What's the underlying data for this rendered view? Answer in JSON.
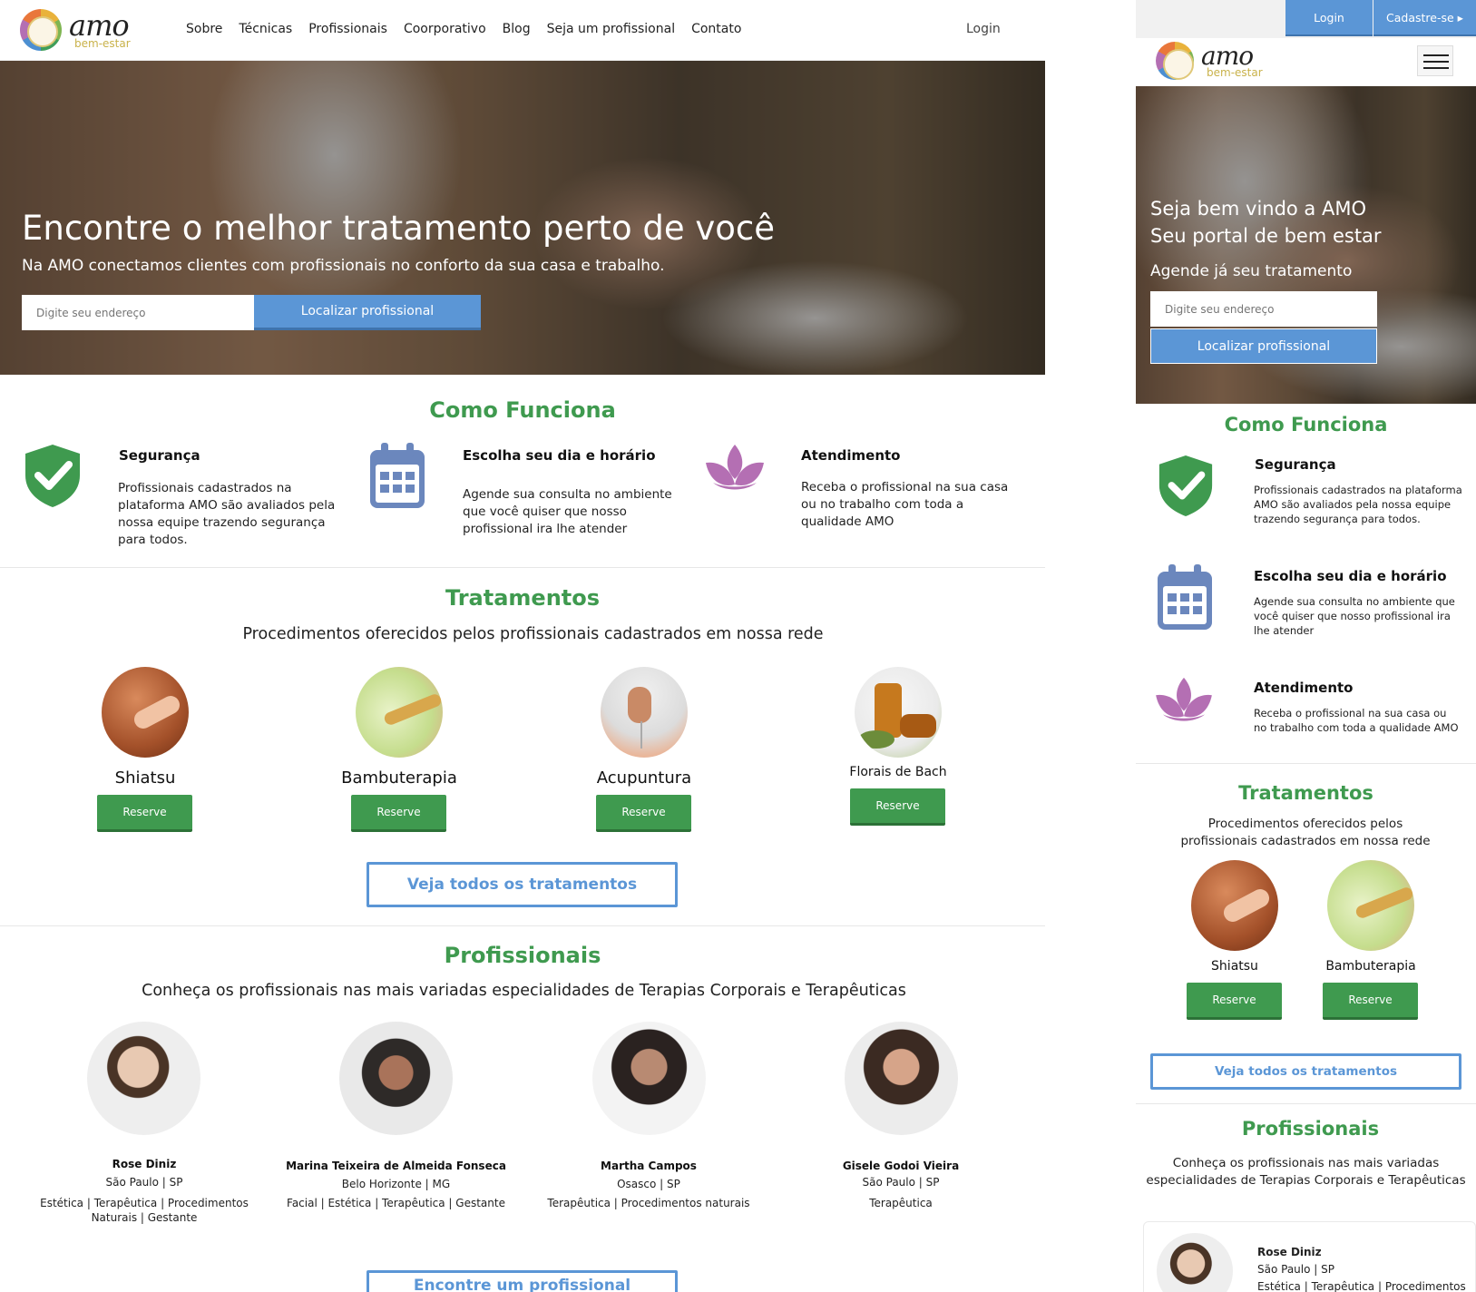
{
  "brand": {
    "name": "amo",
    "tagline": "bem-estar"
  },
  "nav": {
    "items": [
      "Sobre",
      "Técnicas",
      "Profissionais",
      "Coorporativo",
      "Blog",
      "Seja um profissional",
      "Contato"
    ],
    "login": "Login"
  },
  "hero": {
    "title": "Encontre o melhor tratamento perto de você",
    "subtitle": "Na AMO conectamos clientes com profissionais no conforto da sua casa e trabalho.",
    "address_placeholder": "Digite seu endereço",
    "search_button": "Localizar profissional"
  },
  "como_funciona": {
    "title": "Como Funciona",
    "items": [
      {
        "icon": "shield-check-icon",
        "title": "Segurança",
        "text": "Profissionais cadastrados na plataforma AMO são avaliados pela nossa equipe trazendo segurança para todos."
      },
      {
        "icon": "calendar-icon",
        "title": "Escolha seu dia e horário",
        "text": "Agende sua consulta no ambiente que você quiser que nosso profissional ira lhe atender"
      },
      {
        "icon": "lotus-icon",
        "title": "Atendimento",
        "text": "Receba o profissional na sua casa ou no trabalho com toda a qualidade AMO"
      }
    ]
  },
  "tratamentos": {
    "title": "Tratamentos",
    "subtitle": "Procedimentos oferecidos pelos profissionais cadastrados em nossa rede",
    "items": [
      {
        "name": "Shiatsu",
        "button": "Reserve"
      },
      {
        "name": "Bambuterapia",
        "button": "Reserve"
      },
      {
        "name": "Acupuntura",
        "button": "Reserve"
      },
      {
        "name": "Florais de Bach",
        "button": "Reserve"
      }
    ],
    "see_all": "Veja todos os tratamentos"
  },
  "profissionais": {
    "title": "Profissionais",
    "subtitle": "Conheça os profissionais nas mais variadas especialidades de Terapias Corporais e Terapêuticas",
    "items": [
      {
        "name": "Rose Diniz",
        "location": "São Paulo | SP",
        "tags": "Estética | Terapêutica | Procedimentos Naturais | Gestante"
      },
      {
        "name": "Marina Teixeira de Almeida Fonseca",
        "location": "Belo Horizonte | MG",
        "tags": "Facial | Estética | Terapêutica | Gestante"
      },
      {
        "name": "Martha Campos",
        "location": "Osasco | SP",
        "tags": "Terapêutica | Procedimentos naturais"
      },
      {
        "name": "Gisele Godoi Vieira",
        "location": "São Paulo | SP",
        "tags": "Terapêutica"
      }
    ],
    "find_button": "Encontre um profissional"
  },
  "mobile": {
    "login": "Login",
    "signup": "Cadastre-se ▸",
    "hero_line1": "Seja bem vindo a AMO",
    "hero_line2": "Seu portal de bem estar",
    "hero_line3": "Agende já seu tratamento",
    "address_placeholder": "Digite seu endereço",
    "search_button": "Localizar profissional",
    "mobile_tags_first": "Estética | Terapêutica | Procedimentos"
  },
  "colors": {
    "green": "#3f9a4f",
    "blue": "#5b96d6",
    "lavender": "#b46fb3",
    "calendar": "#6b87bd"
  }
}
